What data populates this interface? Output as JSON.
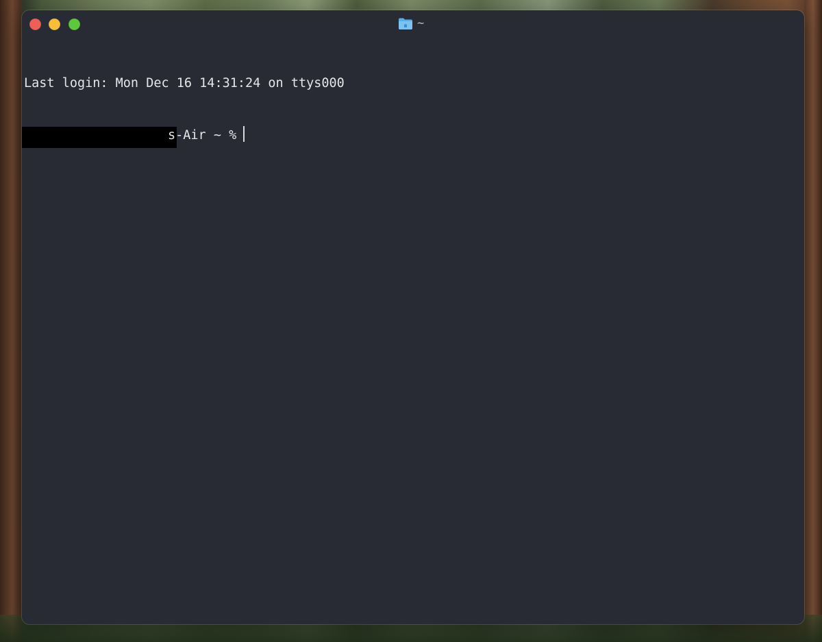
{
  "window": {
    "title": "~",
    "title_icon": "folder-home-icon",
    "accent_colors": {
      "close": "#ee5f57",
      "minimize": "#f6be3b",
      "maximize": "#5fc73f",
      "terminal_bg": "#282b33"
    }
  },
  "terminal": {
    "last_login": "Last login: Mon Dec 16 14:31:24 on ttys000",
    "prompt_visible": "s-Air ~ %"
  }
}
